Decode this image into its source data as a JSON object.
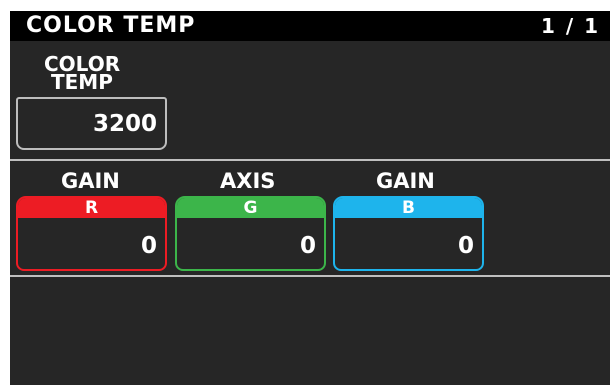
{
  "title_bar": {
    "title": "COLOR TEMP",
    "page_indicator": "1 / 1"
  },
  "color_temp": {
    "label_line1": "COLOR",
    "label_line2": "TEMP",
    "value": "3200"
  },
  "params": [
    {
      "top_label": "GAIN",
      "channel": "R",
      "value": "0",
      "color": "#ed1c24"
    },
    {
      "top_label": "AXIS",
      "channel": "G",
      "value": "0",
      "color": "#3cb54a"
    },
    {
      "top_label": "GAIN",
      "channel": "B",
      "value": "0",
      "color": "#1eb4ec"
    }
  ],
  "colors": {
    "background": "#262626",
    "title_bar": "#000000",
    "divider": "#bfbfbf",
    "outline": "#bdbdbd"
  }
}
